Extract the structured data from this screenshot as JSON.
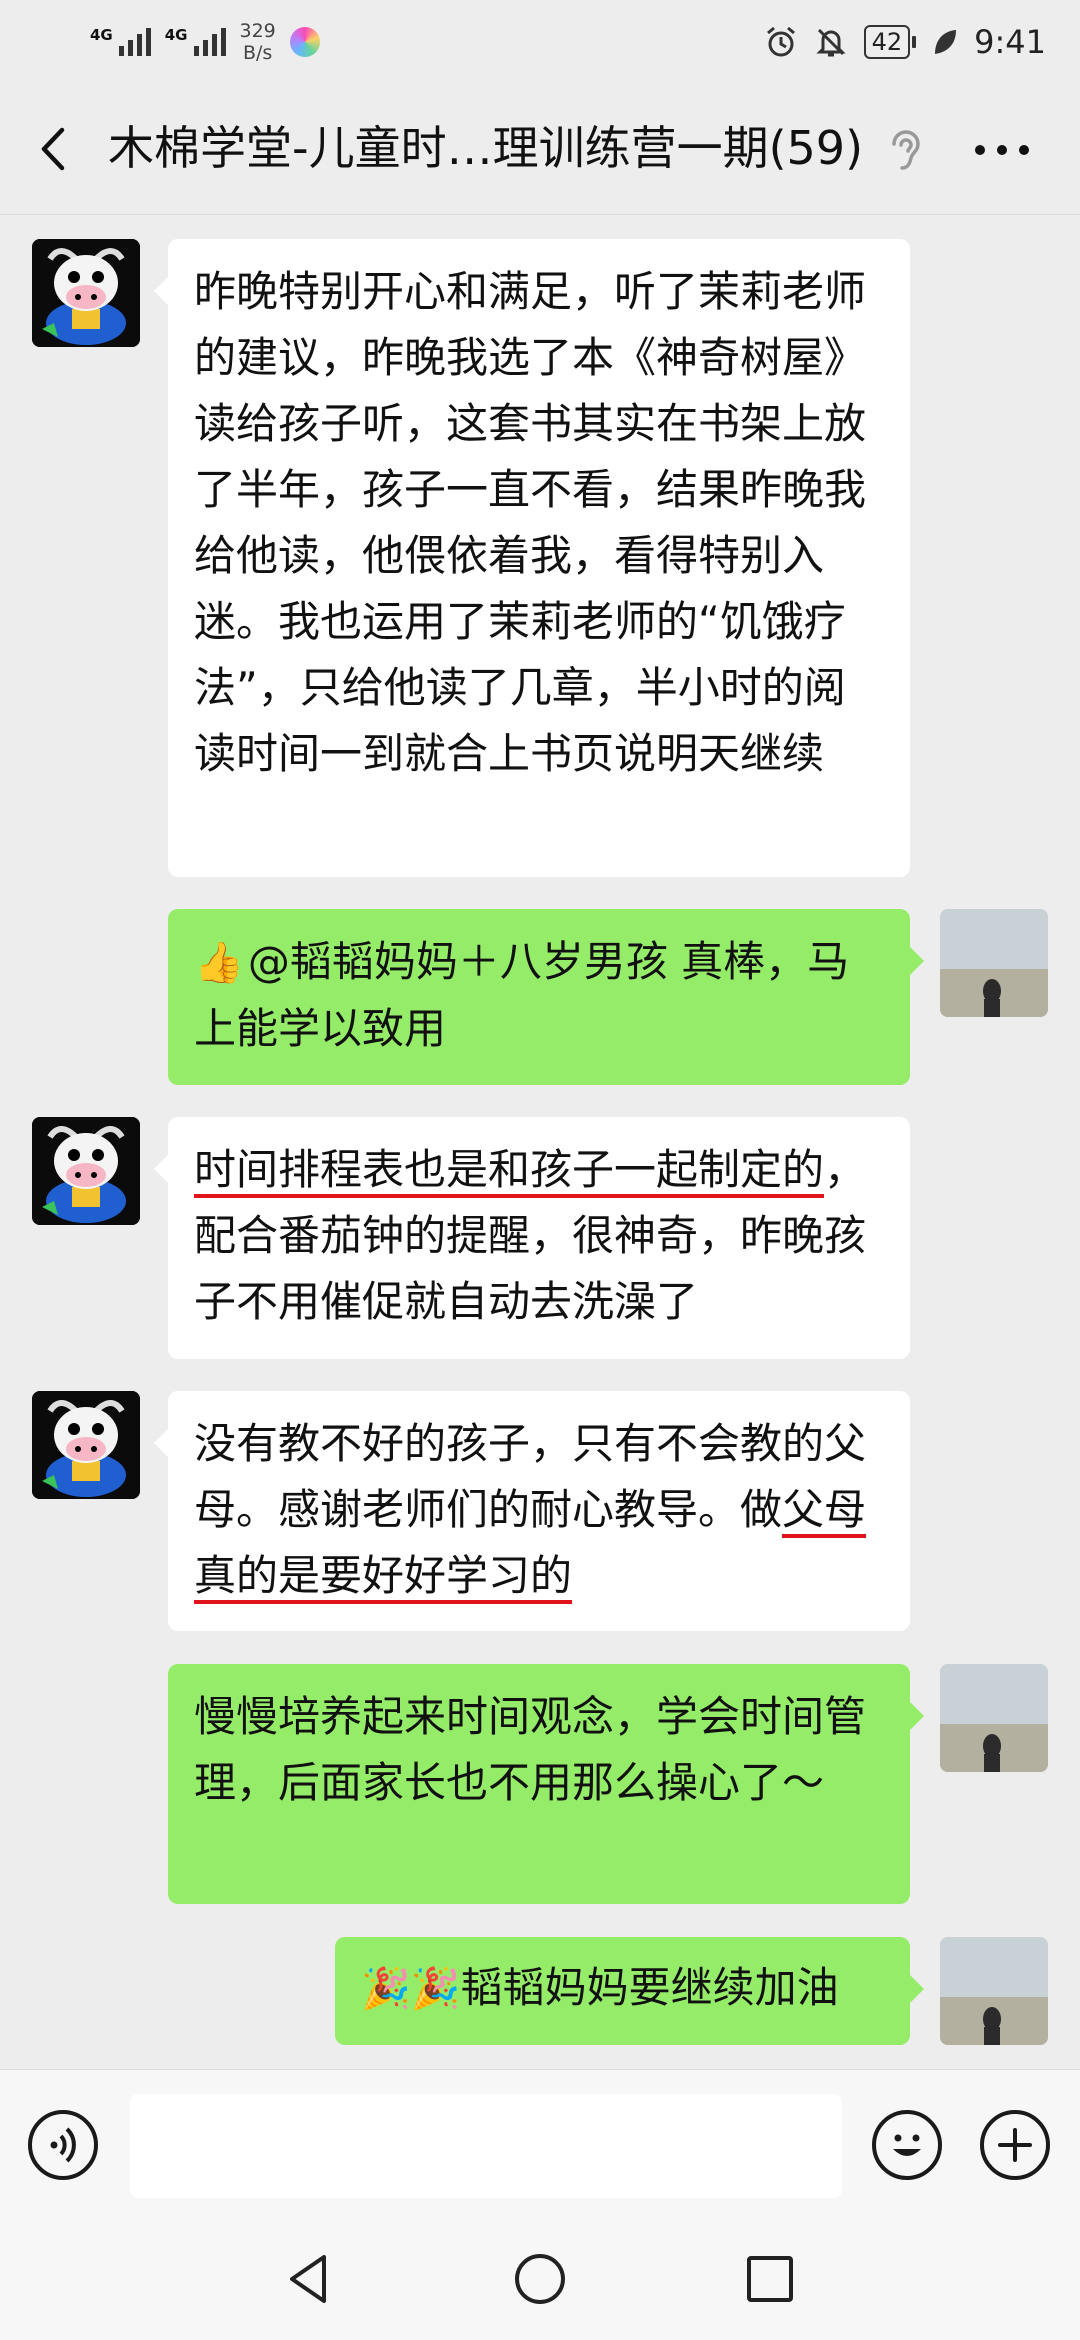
{
  "status_bar": {
    "signal_1_label": "4G",
    "signal_2_label": "4G",
    "net_speed_value": "329",
    "net_speed_unit": "B/s",
    "battery": "42",
    "time": "9:41"
  },
  "header": {
    "title": "木棉学堂-儿童时…理训练营一期(59)"
  },
  "messages": [
    {
      "side": "left",
      "text": "昨晚特别开心和满足，听了茉莉老师的建议，昨晚我选了本《神奇树屋》读给孩子听，这套书其实在书架上放了半年，孩子一直不看，结果昨晚我给他读，他偎依着我，看得特别入迷。我也运用了茉莉老师的“饥饿疗法”，只给他读了几章，半小时的阅读时间一到就合上书页说明天继续"
    },
    {
      "side": "right",
      "emoji": "👍",
      "text": "@韬韬妈妈＋八岁男孩  真棒，马上能学以致用"
    },
    {
      "side": "left",
      "text_underlined": "时间排程表也是和孩子一起制定的",
      "text_rest": "，配合番茄钟的提醒，很神奇，昨晚孩子不用催促就自动去洗澡了"
    },
    {
      "side": "left",
      "text_plain": "没有教不好的孩子，只有不会教的父母。感谢老师们的耐心教导。做",
      "text_underlined": "父母真的是要好好学习的"
    },
    {
      "side": "right",
      "text": "慢慢培养起来时间观念，学会时间管理，后面家长也不用那么操心了～"
    },
    {
      "side": "right",
      "emoji": "🎉🎉",
      "text": "韬韬妈妈要继续加油"
    }
  ],
  "input_bar": {
    "message_value": ""
  },
  "icons": {
    "back": "chevron-left-icon",
    "ear": "ear-icon",
    "more": "more-dots-icon",
    "voice": "voice-icon",
    "emoji": "emoji-icon",
    "add": "plus-icon",
    "nav_back": "triangle-back-icon",
    "nav_home": "circle-home-icon",
    "nav_recent": "square-recent-icon"
  },
  "colors": {
    "background": "#ededed",
    "self_bubble": "#95ec69",
    "other_bubble": "#ffffff",
    "underline": "#e0141a"
  }
}
